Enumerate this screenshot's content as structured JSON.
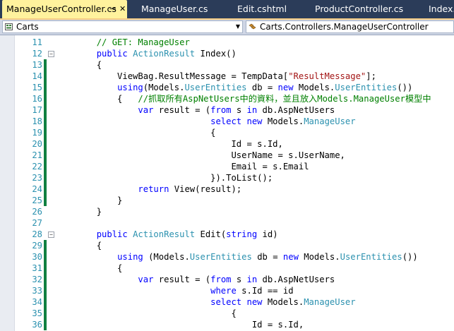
{
  "tabs": [
    {
      "label": "ManageUserController.cs",
      "active": true
    },
    {
      "label": "ManageUser.cs",
      "active": false
    },
    {
      "label": "Edit.cshtml",
      "active": false
    },
    {
      "label": "ProductController.cs",
      "active": false
    },
    {
      "label": "Index.",
      "active": false
    }
  ],
  "navbar": {
    "project": "Carts",
    "type": "Carts.Controllers.ManageUserController"
  },
  "lines": [
    {
      "n": "11",
      "changed": false,
      "fold": "",
      "tokens": [
        [
          "pl",
          "        "
        ],
        [
          "cm",
          "// GET: ManageUser"
        ]
      ]
    },
    {
      "n": "12",
      "changed": false,
      "fold": "−",
      "tokens": [
        [
          "pl",
          "        "
        ],
        [
          "kw",
          "public "
        ],
        [
          "ty",
          "ActionResult"
        ],
        [
          "pl",
          " Index()"
        ]
      ]
    },
    {
      "n": "13",
      "changed": true,
      "fold": "",
      "tokens": [
        [
          "pl",
          "        {"
        ]
      ]
    },
    {
      "n": "14",
      "changed": true,
      "fold": "",
      "tokens": [
        [
          "pl",
          "            ViewBag.ResultMessage = TempData["
        ],
        [
          "st",
          "\"ResultMessage\""
        ],
        [
          "pl",
          "];"
        ]
      ]
    },
    {
      "n": "15",
      "changed": true,
      "fold": "",
      "tokens": [
        [
          "pl",
          "            "
        ],
        [
          "kw",
          "using"
        ],
        [
          "pl",
          "(Models."
        ],
        [
          "ty",
          "UserEntities"
        ],
        [
          "pl",
          " db = "
        ],
        [
          "kw",
          "new "
        ],
        [
          "pl",
          "Models."
        ],
        [
          "ty",
          "UserEntities"
        ],
        [
          "pl",
          "())"
        ]
      ]
    },
    {
      "n": "16",
      "changed": true,
      "fold": "",
      "tokens": [
        [
          "pl",
          "            {   "
        ],
        [
          "cm",
          "//抓取所有AspNetUsers中的資料，並且放入Models.ManageUser模型中"
        ]
      ]
    },
    {
      "n": "17",
      "changed": true,
      "fold": "",
      "tokens": [
        [
          "pl",
          "                "
        ],
        [
          "kw",
          "var "
        ],
        [
          "pl",
          "result = ("
        ],
        [
          "kw",
          "from "
        ],
        [
          "pl",
          "s "
        ],
        [
          "kw",
          "in "
        ],
        [
          "pl",
          "db.AspNetUsers"
        ]
      ]
    },
    {
      "n": "18",
      "changed": true,
      "fold": "",
      "tokens": [
        [
          "pl",
          "                              "
        ],
        [
          "kw",
          "select new "
        ],
        [
          "pl",
          "Models."
        ],
        [
          "ty",
          "ManageUser"
        ]
      ]
    },
    {
      "n": "19",
      "changed": true,
      "fold": "",
      "tokens": [
        [
          "pl",
          "                              {"
        ]
      ]
    },
    {
      "n": "20",
      "changed": true,
      "fold": "",
      "tokens": [
        [
          "pl",
          "                                  Id = s.Id,"
        ]
      ]
    },
    {
      "n": "21",
      "changed": true,
      "fold": "",
      "tokens": [
        [
          "pl",
          "                                  UserName = s.UserName,"
        ]
      ]
    },
    {
      "n": "22",
      "changed": true,
      "fold": "",
      "tokens": [
        [
          "pl",
          "                                  Email = s.Email"
        ]
      ]
    },
    {
      "n": "23",
      "changed": true,
      "fold": "",
      "tokens": [
        [
          "pl",
          "                              }).ToList();"
        ]
      ]
    },
    {
      "n": "24",
      "changed": true,
      "fold": "",
      "tokens": [
        [
          "pl",
          "                "
        ],
        [
          "kw",
          "return "
        ],
        [
          "pl",
          "View(result);"
        ]
      ]
    },
    {
      "n": "25",
      "changed": true,
      "fold": "",
      "tokens": [
        [
          "pl",
          "            }"
        ]
      ]
    },
    {
      "n": "26",
      "changed": false,
      "fold": "",
      "tokens": [
        [
          "pl",
          "        }"
        ]
      ]
    },
    {
      "n": "27",
      "changed": false,
      "fold": "",
      "tokens": []
    },
    {
      "n": "28",
      "changed": false,
      "fold": "−",
      "tokens": [
        [
          "pl",
          "        "
        ],
        [
          "kw",
          "public "
        ],
        [
          "ty",
          "ActionResult"
        ],
        [
          "pl",
          " Edit("
        ],
        [
          "kw",
          "string "
        ],
        [
          "pl",
          "id)"
        ]
      ]
    },
    {
      "n": "29",
      "changed": true,
      "fold": "",
      "tokens": [
        [
          "pl",
          "        {"
        ]
      ]
    },
    {
      "n": "30",
      "changed": true,
      "fold": "",
      "tokens": [
        [
          "pl",
          "            "
        ],
        [
          "kw",
          "using "
        ],
        [
          "pl",
          "(Models."
        ],
        [
          "ty",
          "UserEntities"
        ],
        [
          "pl",
          " db = "
        ],
        [
          "kw",
          "new "
        ],
        [
          "pl",
          "Models."
        ],
        [
          "ty",
          "UserEntities"
        ],
        [
          "pl",
          "())"
        ]
      ]
    },
    {
      "n": "31",
      "changed": true,
      "fold": "",
      "tokens": [
        [
          "pl",
          "            {"
        ]
      ]
    },
    {
      "n": "32",
      "changed": true,
      "fold": "",
      "tokens": [
        [
          "pl",
          "                "
        ],
        [
          "kw",
          "var "
        ],
        [
          "pl",
          "result = ("
        ],
        [
          "kw",
          "from "
        ],
        [
          "pl",
          "s "
        ],
        [
          "kw",
          "in "
        ],
        [
          "pl",
          "db.AspNetUsers"
        ]
      ]
    },
    {
      "n": "33",
      "changed": true,
      "fold": "",
      "tokens": [
        [
          "pl",
          "                              "
        ],
        [
          "kw",
          "where "
        ],
        [
          "pl",
          "s.Id == id"
        ]
      ]
    },
    {
      "n": "34",
      "changed": true,
      "fold": "",
      "tokens": [
        [
          "pl",
          "                              "
        ],
        [
          "kw",
          "select new "
        ],
        [
          "pl",
          "Models."
        ],
        [
          "ty",
          "ManageUser"
        ]
      ]
    },
    {
      "n": "35",
      "changed": true,
      "fold": "",
      "tokens": [
        [
          "pl",
          "                                  {"
        ]
      ]
    },
    {
      "n": "36",
      "changed": true,
      "fold": "",
      "tokens": [
        [
          "pl",
          "                                      Id = s.Id,"
        ]
      ]
    }
  ],
  "colors": {
    "keyword": "#0000ff",
    "type": "#2b91af",
    "string": "#a31515",
    "comment": "#008000",
    "line_number": "#2b91af",
    "change_marker": "#108040",
    "active_tab": "#fff29d",
    "tab_strip": "#2b3c59"
  }
}
